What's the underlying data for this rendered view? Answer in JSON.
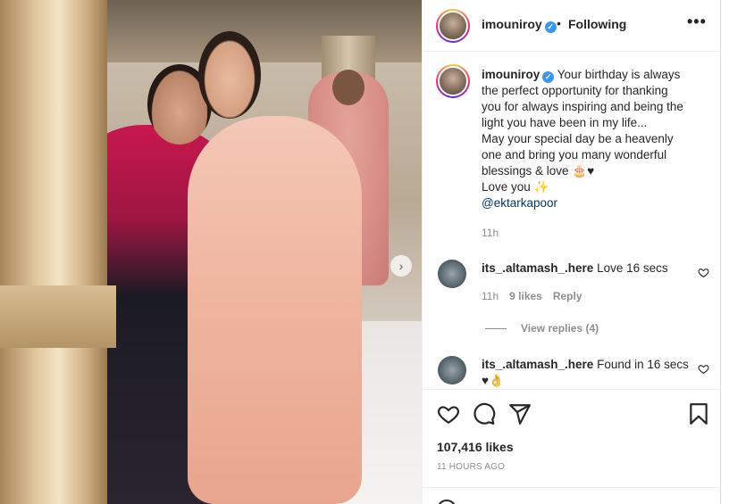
{
  "post": {
    "username": "imouniroy",
    "verified_mark": "✓",
    "separator": "•",
    "follow_status": "Following",
    "more_label": "•••",
    "caption": {
      "username": "imouniroy",
      "text_lines": [
        "Your birthday is always",
        "the perfect opportunity for thanking",
        "you for always inspiring and being the",
        "light you have been in my life...",
        "May your special day be a heavenly",
        "one and bring you many wonderful",
        "blessings & love 🎂♥",
        "Love you ✨"
      ],
      "mention": "@ektarkapoor",
      "time": "11h"
    },
    "comments": [
      {
        "username": "its_.altamash_.here",
        "text": "Love 16 secs",
        "time": "11h",
        "likes": "9 likes",
        "reply_label": "Reply",
        "view_replies": "View replies (4)"
      },
      {
        "username": "its_.altamash_.here",
        "text": "Found in 16 secs",
        "text_line2": "♥👌"
      }
    ],
    "likes": "107,416 likes",
    "posted_ago": "11 HOURS AGO"
  },
  "photo": {
    "carousel_arrow": "›"
  },
  "icons": {
    "like": "heart-icon",
    "comment": "comment-icon",
    "share": "paper-plane-icon",
    "save": "bookmark-icon"
  }
}
